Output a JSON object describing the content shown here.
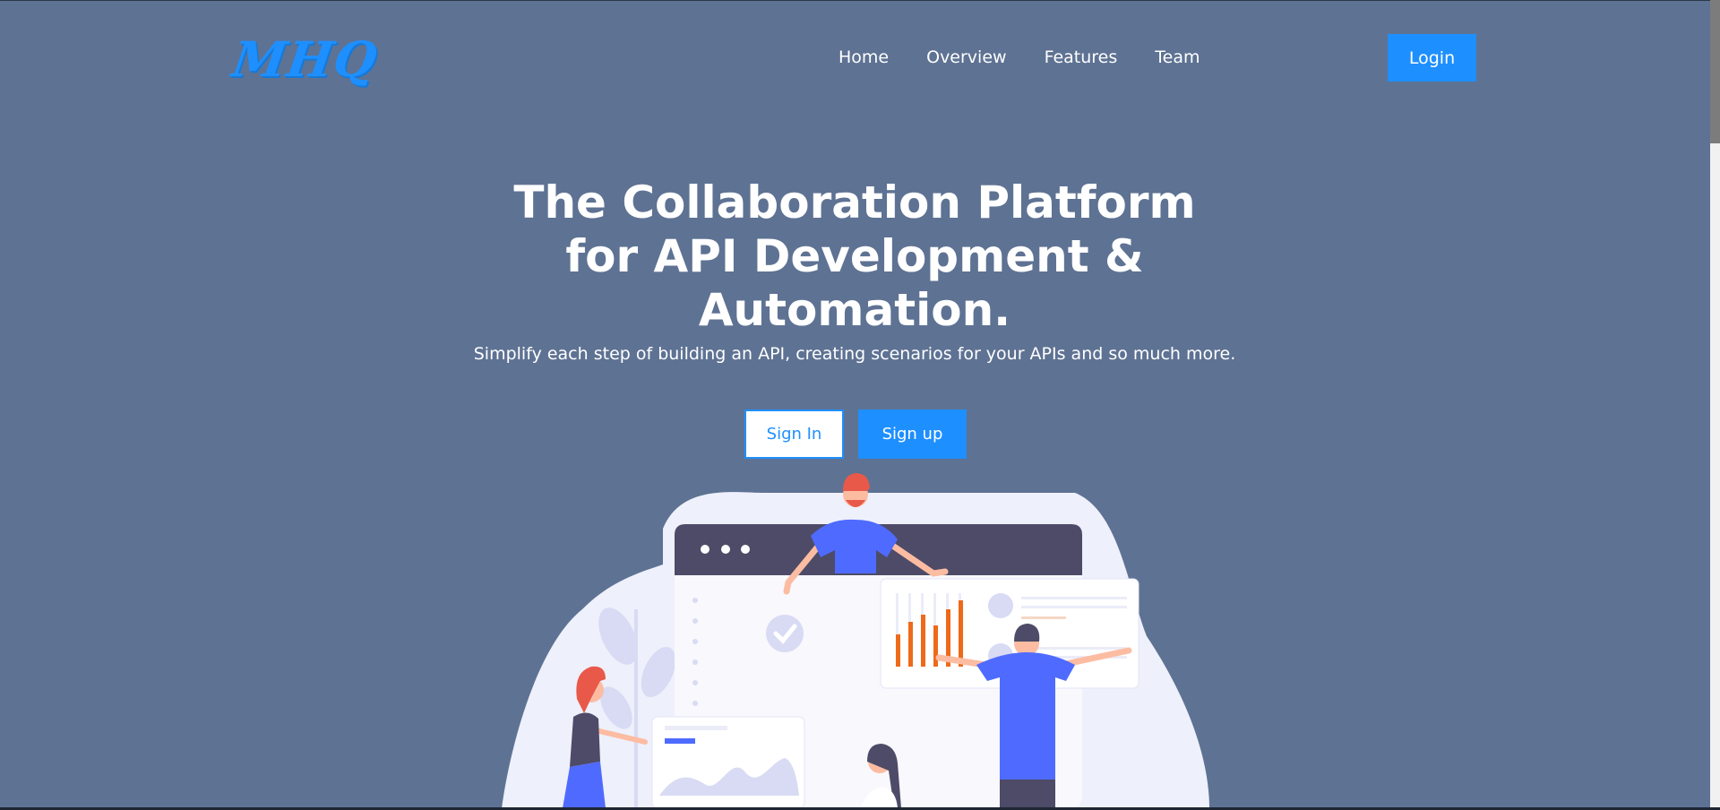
{
  "header": {
    "logo_text": "MHQ",
    "nav": [
      "Home",
      "Overview",
      "Features",
      "Team"
    ],
    "login_label": "Login"
  },
  "hero": {
    "title_lines": [
      "The Collaboration Platform",
      "for API Development &",
      "Automation."
    ],
    "subtitle": "Simplify each step of building an API, creating scenarios for your APIs and so much more.",
    "signin_label": "Sign In",
    "signup_label": "Sign up"
  },
  "colors": {
    "background": "#5e7293",
    "accent": "#1e8fff",
    "illustration_blue": "#4f6bff",
    "illustration_orange": "#ee6a1a",
    "illustration_dark": "#4d4b67"
  }
}
